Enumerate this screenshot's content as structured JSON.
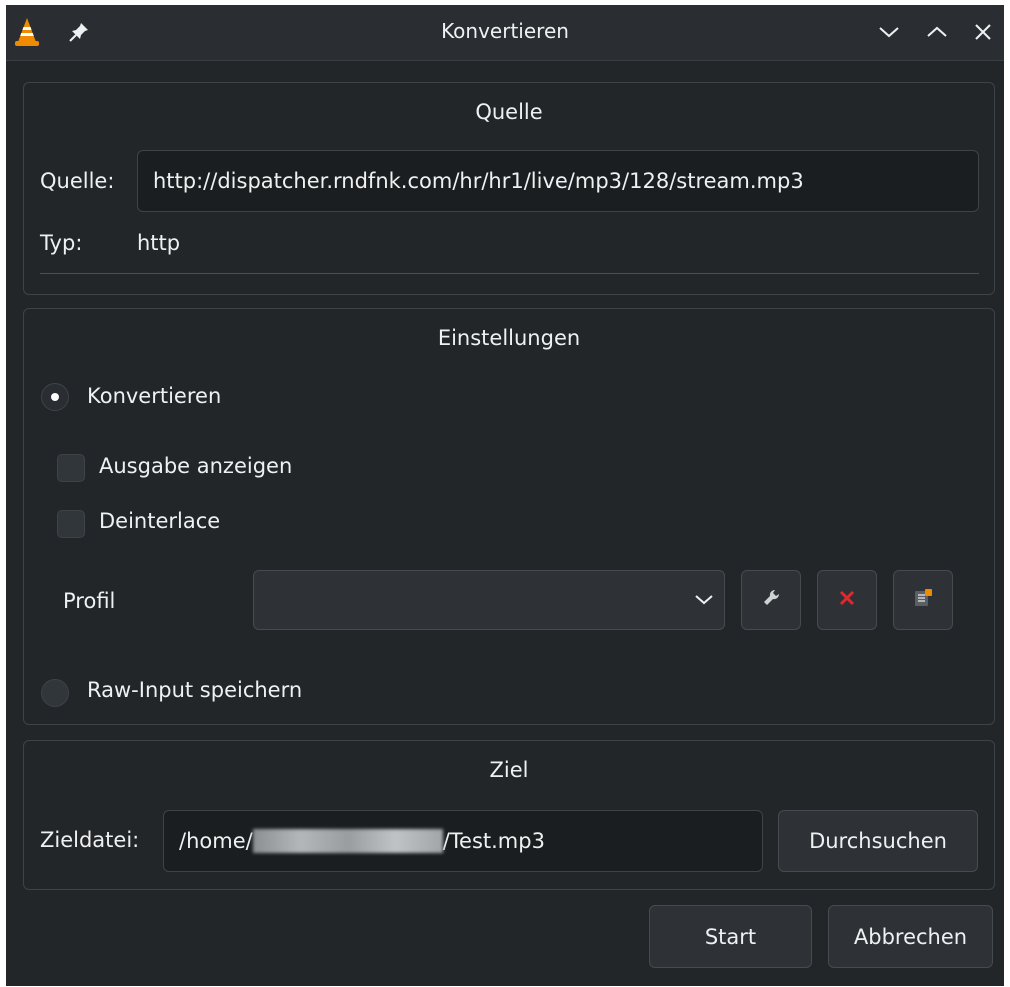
{
  "window": {
    "title": "Konvertieren",
    "icons": [
      "vlc-cone-icon",
      "pin-icon",
      "minimize-icon",
      "maximize-icon",
      "close-icon"
    ]
  },
  "source": {
    "group_title": "Quelle",
    "source_label": "Quelle:",
    "source_value": "http://dispatcher.rndfnk.com/hr/hr1/live/mp3/128/stream.mp3",
    "type_label": "Typ:",
    "type_value": "http"
  },
  "settings": {
    "group_title": "Einstellungen",
    "convert_radio_label": "Konvertieren",
    "convert_selected": true,
    "show_output_label": "Ausgabe anzeigen",
    "show_output_checked": false,
    "deinterlace_label": "Deinterlace",
    "deinterlace_checked": false,
    "profile_label": "Profil",
    "profile_value": "",
    "raw_input_label": "Raw-Input speichern",
    "raw_input_selected": false
  },
  "target": {
    "group_title": "Ziel",
    "dest_label": "Zieldatei:",
    "dest_prefix": "/home/",
    "dest_suffix": "/Test.mp3",
    "browse_label": "Durchsuchen"
  },
  "actions": {
    "start_label": "Start",
    "cancel_label": "Abbrechen"
  },
  "colors": {
    "background": "#232629",
    "accent_red": "#e0282e",
    "vlc_orange": "#f08a00"
  }
}
